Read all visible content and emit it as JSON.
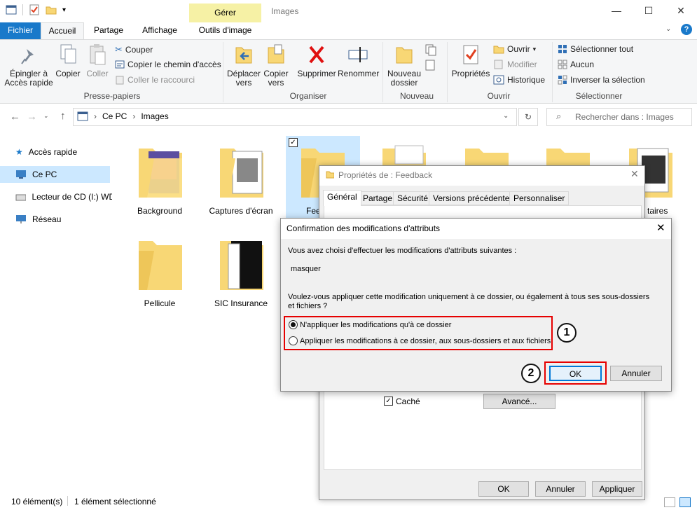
{
  "window": {
    "title": "Images",
    "context_tab": "Gérer"
  },
  "tabs": [
    "Fichier",
    "Accueil",
    "Partage",
    "Affichage",
    "Outils d'image"
  ],
  "ribbon": {
    "presse_papiers": {
      "label": "Presse-papiers",
      "pin": "Épingler à\nAccès rapide",
      "copier": "Copier",
      "coller": "Coller",
      "couper": "Couper",
      "copier_chemin": "Copier le chemin d'accès",
      "coller_raccourci": "Coller le raccourci"
    },
    "organiser": {
      "label": "Organiser",
      "deplacer": "Déplacer\nvers",
      "copier_vers": "Copier\nvers",
      "supprimer": "Supprimer",
      "renommer": "Renommer"
    },
    "nouveau": {
      "label": "Nouveau",
      "nouveau_dossier": "Nouveau\ndossier"
    },
    "ouvrir": {
      "label": "Ouvrir",
      "proprietes": "Propriétés",
      "ouvrir": "Ouvrir",
      "modifier": "Modifier",
      "historique": "Historique"
    },
    "selectionner": {
      "label": "Sélectionner",
      "tout": "Sélectionner tout",
      "aucun": "Aucun",
      "inverser": "Inverser la sélection"
    }
  },
  "address": {
    "crumbs": [
      "Ce PC",
      "Images"
    ],
    "search_placeholder": "Rechercher dans : Images"
  },
  "nav": [
    {
      "label": "Accès rapide",
      "icon": "star-icon"
    },
    {
      "label": "Ce PC",
      "icon": "computer-icon"
    },
    {
      "label": "Lecteur de CD (I:) WD",
      "icon": "cd-drive-icon"
    },
    {
      "label": "Réseau",
      "icon": "network-icon"
    }
  ],
  "files": [
    "Background",
    "Captures d'écran",
    "Fee",
    "",
    "",
    "",
    "taires",
    "Pellicule",
    "SIC Insurance"
  ],
  "status": {
    "count": "10 élément(s)",
    "selected": "1 élément sélectionné"
  },
  "properties": {
    "title": "Propriétés de : Feedback",
    "tabs": [
      "Général",
      "Partage",
      "Sécurité",
      "Versions précédentes",
      "Personnaliser"
    ],
    "cache": "Caché",
    "avance": "Avancé...",
    "ok": "OK",
    "annuler": "Annuler",
    "appliquer": "Appliquer"
  },
  "confirm": {
    "title": "Confirmation des modifications d'attributs",
    "intro": "Vous avez choisi d'effectuer les modifications d'attributs suivantes :",
    "change": "masquer",
    "question": "Voulez-vous appliquer cette modification uniquement à ce dossier, ou également à tous ses sous-dossiers et fichiers ?",
    "option1": "N'appliquer les modifications qu'à ce dossier",
    "option2": "Appliquer les modifications à ce dossier, aux sous-dossiers et aux fichiers",
    "ok": "OK",
    "annuler": "Annuler",
    "marker1": "1",
    "marker2": "2"
  },
  "colors": {
    "accent": "#1979ca",
    "highlight": "#cce8ff",
    "annotation": "#e60000"
  }
}
